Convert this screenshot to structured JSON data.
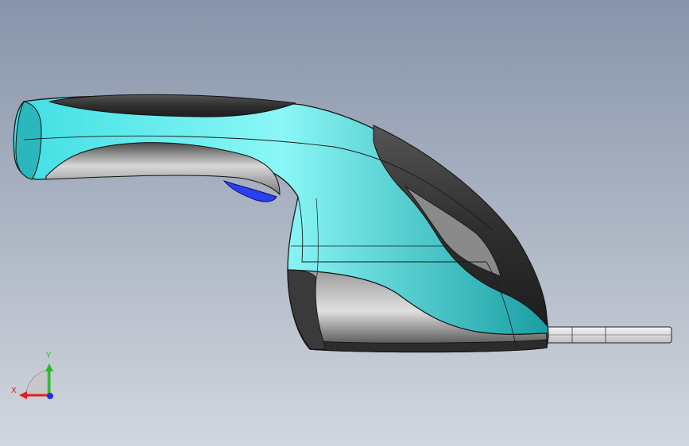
{
  "viewport": {
    "background_top": "#8794aa",
    "background_bottom": "#d2d6de"
  },
  "model": {
    "teal": "#2fd3d6",
    "teal_light": "#8ff4f4",
    "dark_gray": "#3a3a3a",
    "mid_gray": "#8e8e8e",
    "light_gray": "#d9d9d9",
    "trigger_blue": "#2a3ff0"
  },
  "triad": {
    "x_label": "X",
    "y_label": "Y",
    "x_color": "#e02020",
    "y_color": "#20c020",
    "z_color": "#2030e0"
  }
}
